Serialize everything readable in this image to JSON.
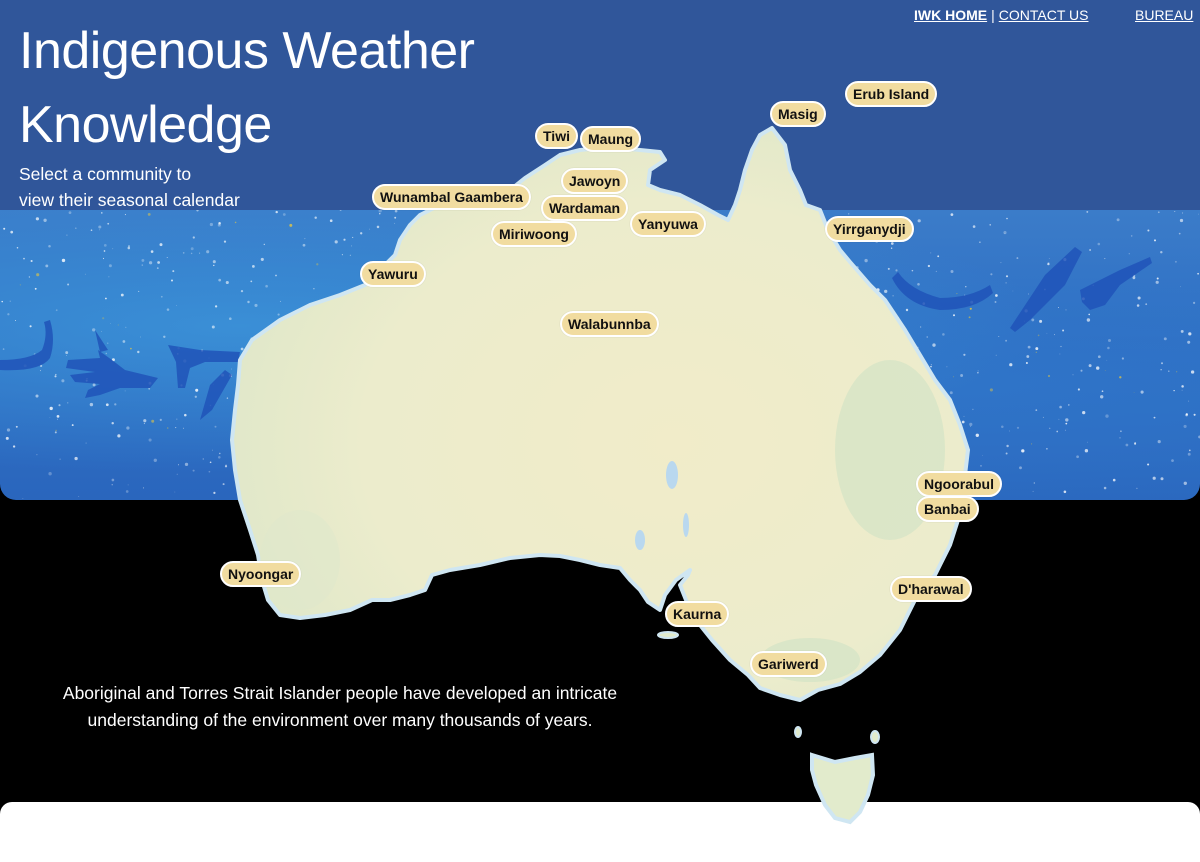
{
  "header": {
    "title_line1": "Indigenous Weather",
    "title_line2": "Knowledge",
    "subtitle_line1": "Select a community to",
    "subtitle_line2": "view their seasonal calendar"
  },
  "nav": {
    "home": "IWK HOME",
    "separator": "|",
    "contact": "CONTACT US",
    "bureau": "BUREAU"
  },
  "communities": [
    {
      "id": "erub-island",
      "label": "Erub Island"
    },
    {
      "id": "masig",
      "label": "Masig"
    },
    {
      "id": "tiwi",
      "label": "Tiwi"
    },
    {
      "id": "maung",
      "label": "Maung"
    },
    {
      "id": "jawoyn",
      "label": "Jawoyn"
    },
    {
      "id": "wunambal-gaambera",
      "label": "Wunambal Gaambera"
    },
    {
      "id": "wardaman",
      "label": "Wardaman"
    },
    {
      "id": "yanyuwa",
      "label": "Yanyuwa"
    },
    {
      "id": "miriwoong",
      "label": "Miriwoong"
    },
    {
      "id": "yirrganydji",
      "label": "Yirrganydji"
    },
    {
      "id": "yawuru",
      "label": "Yawuru"
    },
    {
      "id": "walabunnba",
      "label": "Walabunnba"
    },
    {
      "id": "ngoorabul",
      "label": "Ngoorabul"
    },
    {
      "id": "banbai",
      "label": "Banbai"
    },
    {
      "id": "nyoongar",
      "label": "Nyoongar"
    },
    {
      "id": "dharawal",
      "label": "D'harawal"
    },
    {
      "id": "kaurna",
      "label": "Kaurna"
    },
    {
      "id": "gariwerd",
      "label": "Gariwerd"
    }
  ],
  "intro": {
    "line1": "Aboriginal and Torres Strait Islander people have developed an intricate",
    "line2": "understanding of the environment over many thousands of years."
  },
  "colors": {
    "header_blue": "#30569a",
    "pill_fill": "#f1dca0",
    "land": "#eeeccf",
    "background": "#000000"
  }
}
